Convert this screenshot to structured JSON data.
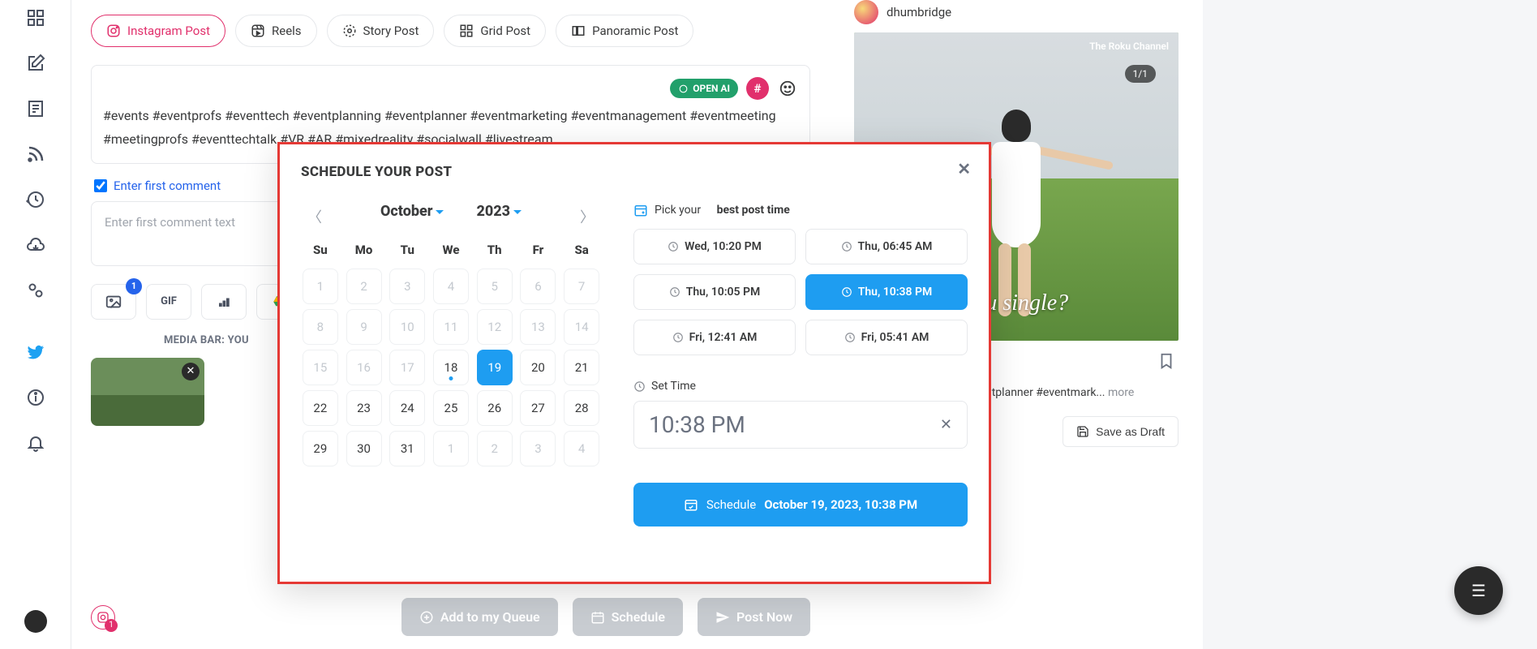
{
  "tabs": {
    "instagram": "Instagram Post",
    "reels": "Reels",
    "story": "Story Post",
    "grid": "Grid Post",
    "panoramic": "Panoramic Post"
  },
  "composer": {
    "ai_badge": "OPEN AI",
    "hash": "#",
    "text": "#events #eventprofs #eventtech #eventplanning #eventplanner #eventmarketing #eventmanagement #eventmeeting #meetingprofs #eventtechtalk #VR #AR #mixedreality #socialwall #livestream"
  },
  "first_comment": {
    "label": "Enter first comment",
    "placeholder": "Enter first comment text"
  },
  "media": {
    "gif": "GIF",
    "badge": "1",
    "bar_label": "MEDIA BAR: YOU"
  },
  "footer": {
    "queue": "Add to my Queue",
    "schedule": "Schedule",
    "post_now": "Post Now",
    "ig_badge": "1"
  },
  "preview": {
    "username": "dhumbridge",
    "roku": "The Roku Channel",
    "count": "1/1",
    "overlay": "you single?",
    "caption_partial": "s #eventprofs #eventtech ntplanner #eventmark...",
    "more": "more",
    "save_draft": "Save as Draft"
  },
  "modal": {
    "title": "SCHEDULE YOUR POST",
    "month": "October",
    "year": "2023",
    "dow": [
      "Su",
      "Mo",
      "Tu",
      "We",
      "Th",
      "Fr",
      "Sa"
    ],
    "days": [
      {
        "n": "1",
        "muted": true
      },
      {
        "n": "2",
        "muted": true
      },
      {
        "n": "3",
        "muted": true
      },
      {
        "n": "4",
        "muted": true
      },
      {
        "n": "5",
        "muted": true
      },
      {
        "n": "6",
        "muted": true
      },
      {
        "n": "7",
        "muted": true
      },
      {
        "n": "8",
        "muted": true
      },
      {
        "n": "9",
        "muted": true
      },
      {
        "n": "10",
        "muted": true
      },
      {
        "n": "11",
        "muted": true
      },
      {
        "n": "12",
        "muted": true
      },
      {
        "n": "13",
        "muted": true
      },
      {
        "n": "14",
        "muted": true
      },
      {
        "n": "15",
        "muted": true
      },
      {
        "n": "16",
        "muted": true
      },
      {
        "n": "17",
        "muted": true
      },
      {
        "n": "18",
        "today": true
      },
      {
        "n": "19",
        "selected": true
      },
      {
        "n": "20"
      },
      {
        "n": "21"
      },
      {
        "n": "22"
      },
      {
        "n": "23"
      },
      {
        "n": "24"
      },
      {
        "n": "25"
      },
      {
        "n": "26"
      },
      {
        "n": "27"
      },
      {
        "n": "28"
      },
      {
        "n": "29"
      },
      {
        "n": "30"
      },
      {
        "n": "31"
      },
      {
        "n": "1",
        "muted": true
      },
      {
        "n": "2",
        "muted": true
      },
      {
        "n": "3",
        "muted": true
      },
      {
        "n": "4",
        "muted": true
      }
    ],
    "pick_label_a": "Pick your",
    "pick_label_b": "best post time",
    "slots": [
      {
        "t": "Wed, 10:20 PM"
      },
      {
        "t": "Thu, 06:45 AM"
      },
      {
        "t": "Thu, 10:05 PM"
      },
      {
        "t": "Thu, 10:38 PM",
        "active": true
      },
      {
        "t": "Fri, 12:41 AM"
      },
      {
        "t": "Fri, 05:41 AM"
      }
    ],
    "set_time_label": "Set Time",
    "time_value": "10:38 PM",
    "schedule_label": "Schedule",
    "schedule_date": "October 19, 2023, 10:38 PM"
  }
}
